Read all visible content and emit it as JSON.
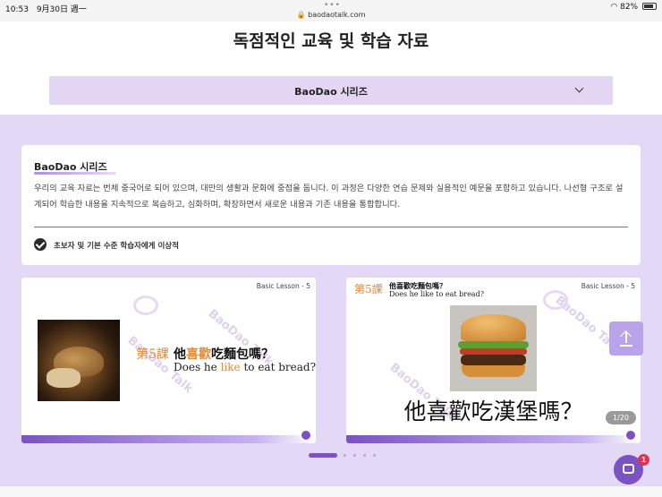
{
  "status_bar": {
    "time": "10:53",
    "date": "9月30日 週一",
    "url": "baodaotalk.com",
    "dots": "•••",
    "wifi_icon": "wifi-icon",
    "battery": "82%"
  },
  "page": {
    "title": "독점적인 교육 및 학습 자료"
  },
  "series_select": {
    "selected": "BaoDao 시리즈"
  },
  "info_card": {
    "title": "BaoDao 시리즈",
    "description": "우리의 교육 자료는 번체 중국어로 되어 있으며, 대만의 생활과 문화에 중점을 둡니다. 이 과정은 다양한 연습 문제와 실용적인 예문을 포함하고 있습니다. 나선형 구조로 설계되어 학습한 내용을 지속적으로 복습하고, 심화하며, 확장하면서 새로운 내용과 기존 내용을 통합합니다.",
    "check_item": "초보자 및 기본 수준 학습자에게 이상적"
  },
  "slides": [
    {
      "lesson_tag": "Basic Lesson - 5",
      "lesson_label": "第5課",
      "chinese_pre": "他",
      "chinese_hl": "喜歡",
      "chinese_post": "吃麵包嗎？",
      "english_pre": "Does he ",
      "english_hl": "like",
      "english_post": " to eat bread?",
      "image": "bread-photo",
      "watermark": "BaoDao Talk"
    },
    {
      "lesson_tag": "Basic Lesson - 5",
      "lesson_label": "第5課",
      "chinese": "他喜歡吃麵包嗎？",
      "english": "Does he like to eat bread?",
      "big_text": "他喜歡吃漢堡嗎？",
      "image": "hamburger-photo",
      "watermark": "BaoDao Talk"
    }
  ],
  "slide_counter": "1/20",
  "chat_badge": "1",
  "colors": {
    "accent": "#7a52c2",
    "lavender_bg": "#e3d9f6",
    "select_bg": "#e2d6f3",
    "highlight": "#e08a3a",
    "badge": "#e0334f"
  }
}
